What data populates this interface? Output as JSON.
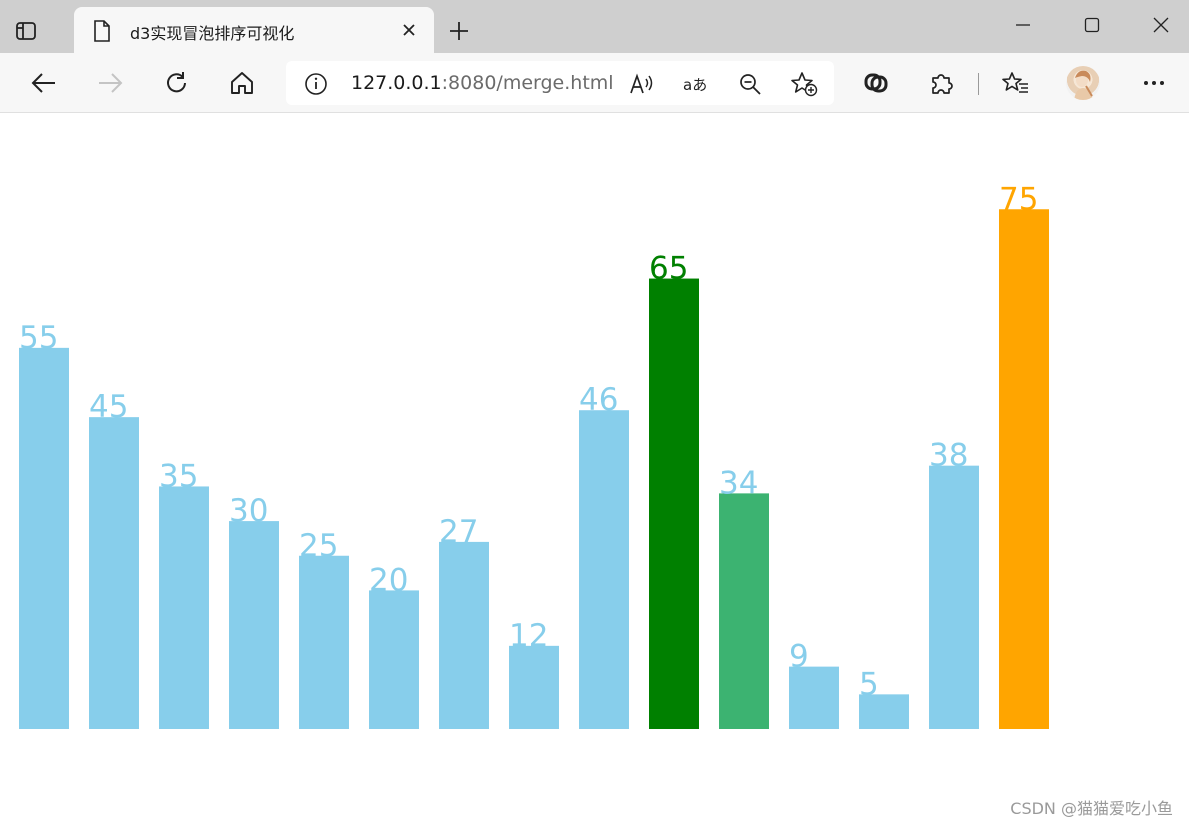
{
  "browser": {
    "tab_title": "d3实现冒泡排序可视化",
    "url_host": "127.0.0.1",
    "url_rest": ":8080/merge.html",
    "icons": {
      "tab_actions": "tab-actions-icon",
      "favicon": "page-icon",
      "close": "close-icon",
      "new_tab": "plus-icon",
      "back": "back-arrow-icon",
      "forward": "forward-arrow-icon",
      "refresh": "refresh-icon",
      "home": "home-icon",
      "info": "info-icon",
      "read_aloud": "read-aloud-icon",
      "translate": "translate-icon",
      "zoom": "zoom-out-icon",
      "favorite": "add-favorite-icon",
      "copilot": "copilot-icon",
      "extensions": "extensions-icon",
      "favorites": "favorites-icon",
      "profile": "avatar",
      "more": "more-icon"
    }
  },
  "chart_data": {
    "type": "bar",
    "values": [
      55,
      45,
      35,
      30,
      25,
      20,
      27,
      12,
      46,
      65,
      34,
      9,
      5,
      38,
      75
    ],
    "colors": [
      "#87ceeb",
      "#87ceeb",
      "#87ceeb",
      "#87ceeb",
      "#87ceeb",
      "#87ceeb",
      "#87ceeb",
      "#87ceeb",
      "#87ceeb",
      "#008000",
      "#3cb371",
      "#87ceeb",
      "#87ceeb",
      "#87ceeb",
      "#ffa500"
    ],
    "label_colors": [
      "#87ceeb",
      "#87ceeb",
      "#87ceeb",
      "#87ceeb",
      "#87ceeb",
      "#87ceeb",
      "#87ceeb",
      "#87ceeb",
      "#87ceeb",
      "#008000",
      "#87ceeb",
      "#87ceeb",
      "#87ceeb",
      "#87ceeb",
      "#ffa500"
    ],
    "ylim": [
      0,
      75
    ]
  },
  "watermark": "CSDN @猫猫爱吃小鱼"
}
